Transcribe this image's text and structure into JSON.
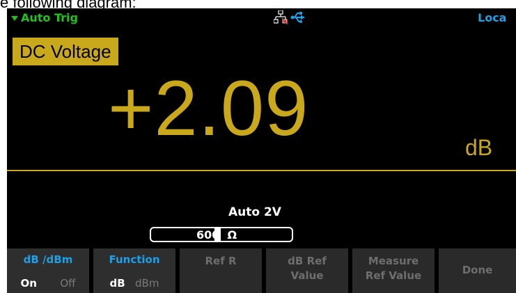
{
  "caption": "e following diagram:",
  "status": {
    "trigger": "Auto Trig",
    "remote": "Loca",
    "icons": [
      "lan-icon",
      "usb-icon"
    ],
    "colors": {
      "trigger": "#21c21b",
      "remote": "#1e9fe6"
    }
  },
  "function_label": "DC Voltage",
  "reading": {
    "value": "+2.09",
    "unit": "dB"
  },
  "range": "Auto 2V",
  "ref_input": {
    "value": "600",
    "unit": "Ω"
  },
  "softkeys": {
    "k1": {
      "title": "dB /dBm",
      "opt1": "On",
      "opt2": "Off"
    },
    "k2": {
      "title": "Function",
      "opt1": "dB",
      "opt2": "dBm"
    },
    "k3": {
      "title": "Ref R"
    },
    "k4": {
      "line1": "dB Ref",
      "line2": "Value"
    },
    "k5": {
      "line1": "Measure",
      "line2": "Ref Value"
    },
    "k6": {
      "title": "Done"
    }
  },
  "colors": {
    "accent": "#c9a81b",
    "background": "#000000",
    "softkey_bg": "#2a2a2a"
  }
}
